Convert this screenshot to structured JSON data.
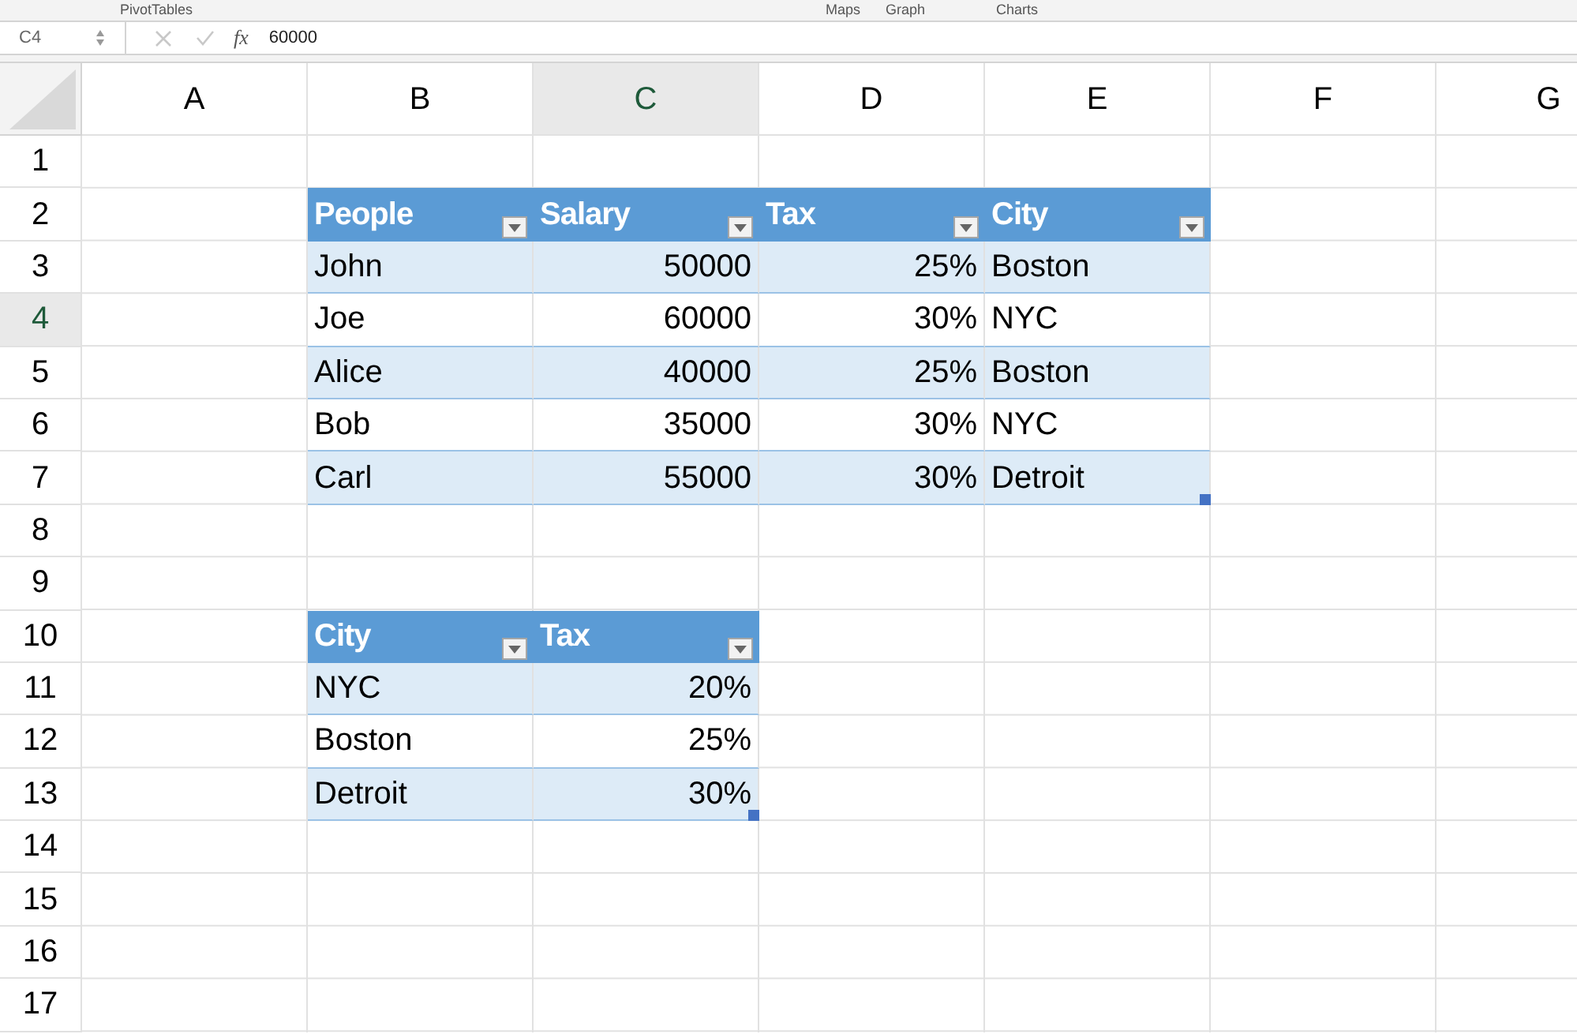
{
  "ribbon": {
    "labels": [
      "PivotTables",
      "Maps",
      "Graph",
      "Charts"
    ]
  },
  "formula_bar": {
    "name_box": "C4",
    "fx": "fx",
    "value": "60000"
  },
  "columns": [
    {
      "label": "A",
      "selected": false
    },
    {
      "label": "B",
      "selected": false
    },
    {
      "label": "C",
      "selected": true
    },
    {
      "label": "D",
      "selected": false
    },
    {
      "label": "E",
      "selected": false
    },
    {
      "label": "F",
      "selected": false
    },
    {
      "label": "G",
      "selected": false
    }
  ],
  "rows": [
    {
      "label": "1",
      "selected": false
    },
    {
      "label": "2",
      "selected": false
    },
    {
      "label": "3",
      "selected": false
    },
    {
      "label": "4",
      "selected": true
    },
    {
      "label": "5",
      "selected": false
    },
    {
      "label": "6",
      "selected": false
    },
    {
      "label": "7",
      "selected": false
    },
    {
      "label": "8",
      "selected": false
    },
    {
      "label": "9",
      "selected": false
    },
    {
      "label": "10",
      "selected": false
    },
    {
      "label": "11",
      "selected": false
    },
    {
      "label": "12",
      "selected": false
    },
    {
      "label": "13",
      "selected": false
    },
    {
      "label": "14",
      "selected": false
    },
    {
      "label": "15",
      "selected": false
    },
    {
      "label": "16",
      "selected": false
    },
    {
      "label": "17",
      "selected": false
    }
  ],
  "tables": [
    {
      "fill_handle": true,
      "columns": [
        {
          "label": "People",
          "kind": "text"
        },
        {
          "label": "Salary",
          "kind": "number"
        },
        {
          "label": "Tax",
          "kind": "number"
        },
        {
          "label": "City",
          "kind": "text"
        }
      ],
      "rows": [
        {
          "banded": true,
          "cells": [
            "John",
            "50000",
            "25%",
            "Boston"
          ]
        },
        {
          "banded": false,
          "cells": [
            "Joe",
            "60000",
            "30%",
            "NYC"
          ]
        },
        {
          "banded": true,
          "cells": [
            "Alice",
            "40000",
            "25%",
            "Boston"
          ]
        },
        {
          "banded": false,
          "cells": [
            "Bob",
            "35000",
            "30%",
            "NYC"
          ]
        },
        {
          "banded": true,
          "cells": [
            "Carl",
            "55000",
            "30%",
            "Detroit"
          ]
        }
      ]
    },
    {
      "fill_handle": true,
      "columns": [
        {
          "label": "City",
          "kind": "text"
        },
        {
          "label": "Tax",
          "kind": "number"
        }
      ],
      "rows": [
        {
          "banded": true,
          "cells": [
            "NYC",
            "20%"
          ]
        },
        {
          "banded": false,
          "cells": [
            "Boston",
            "25%"
          ]
        },
        {
          "banded": true,
          "cells": [
            "Detroit",
            "30%"
          ]
        }
      ]
    }
  ]
}
